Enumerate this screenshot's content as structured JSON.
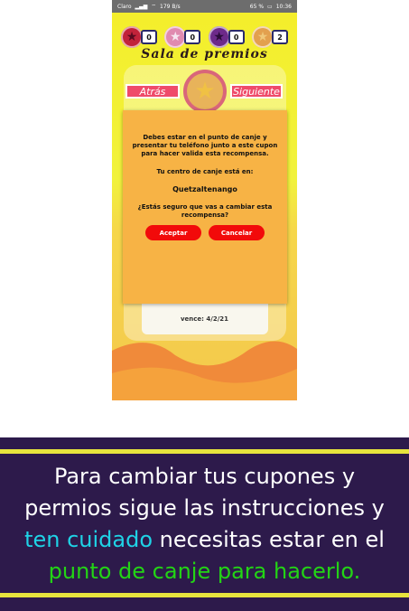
{
  "status_bar": {
    "carrier": "Claro",
    "network_speed": "179 B/s",
    "battery": "65 %",
    "time": "10:36"
  },
  "counters": [
    {
      "icon": "red-star-icon",
      "color": "#c2233a",
      "value": "0"
    },
    {
      "icon": "pink-star-icon",
      "color": "#e08bb0",
      "value": "0"
    },
    {
      "icon": "purple-star-icon",
      "color": "#6d2a8a",
      "value": "0"
    },
    {
      "icon": "gold-star-icon",
      "color": "#e3a04e",
      "value": "2"
    }
  ],
  "screen_title": "Sala de premios",
  "nav": {
    "back_label": "Atrás",
    "next_label": "Siguiente"
  },
  "expiry_label": "vence: 4/2/21",
  "dialog": {
    "message": "Debes estar en el punto de canje y presentar tu teléfono junto a este cupon para hacer valida esta recompensa.",
    "center_label": "Tu centro de canje está en:",
    "center_city": "Quetzaltenango",
    "question": "¿Estás seguro que vas a cambiar esta recompensa?",
    "accept_label": "Aceptar",
    "cancel_label": "Cancelar"
  },
  "banner": {
    "line1": "Para cambiar tus cupones y",
    "line2": "permios  sigue las instrucciones y",
    "highlight_cyan": "ten cuidado",
    "line3_rest": " necesitas estar en el",
    "highlight_green": "punto de canje para hacerlo."
  },
  "colors": {
    "banner_bg": "#2d1a4b",
    "banner_lines": "#e7e43d",
    "button_red": "#f20a0a",
    "dialog_bg": "#f7b345"
  }
}
